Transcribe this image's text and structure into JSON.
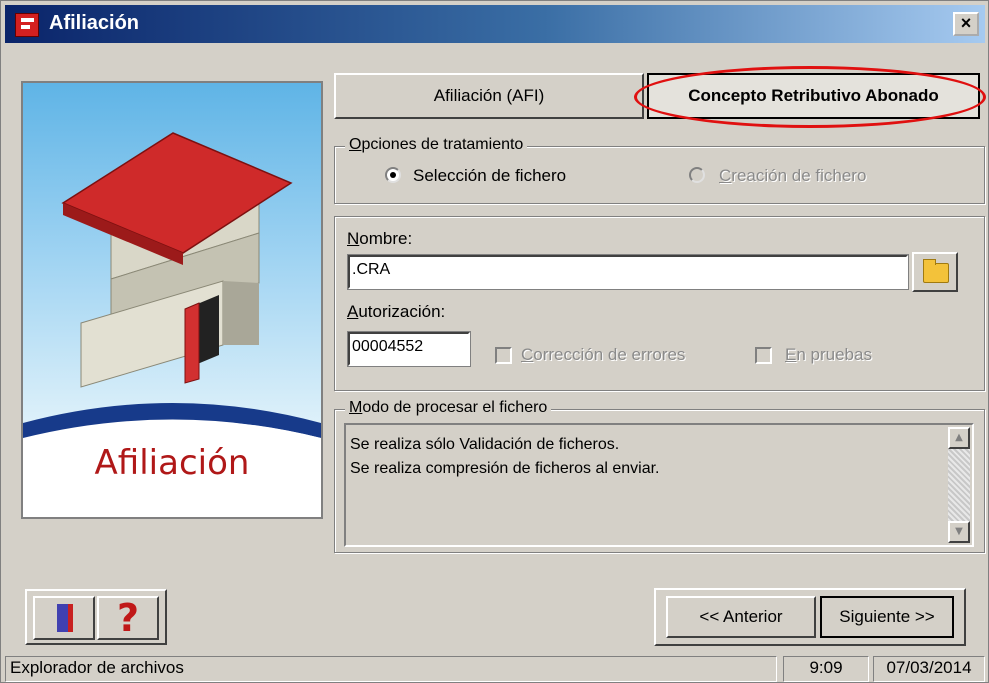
{
  "window": {
    "title": "Afiliación",
    "close_label": "×"
  },
  "illustration": {
    "label": "Afiliación"
  },
  "tabs": [
    {
      "label": "Afiliación (AFI)",
      "active": false
    },
    {
      "label": "Concepto Retributivo Abonado",
      "active": true
    }
  ],
  "highlight_color": "#e01010",
  "options": {
    "legend": "Opciones de tratamiento",
    "seleccion_label": "Selección de fichero",
    "creacion_label": "Creación de fichero",
    "selected": "seleccion"
  },
  "file": {
    "nombre_label": "Nombre:",
    "nombre_value": ".CRA",
    "autorizacion_label": "Autorización:",
    "autorizacion_value": "00004552",
    "correccion_label": "Corrección de errores",
    "pruebas_label": "En pruebas"
  },
  "processing": {
    "legend": "Modo de procesar el fichero",
    "line1": "Se realiza sólo Validación de ficheros.",
    "line2": "Se realiza compresión de ficheros al enviar."
  },
  "nav": {
    "prev_label": "<< Anterior",
    "next_label": "Siguiente >>"
  },
  "statusbar": {
    "text": "Explorador de archivos",
    "time": "9:09",
    "date": "07/03/2014"
  }
}
